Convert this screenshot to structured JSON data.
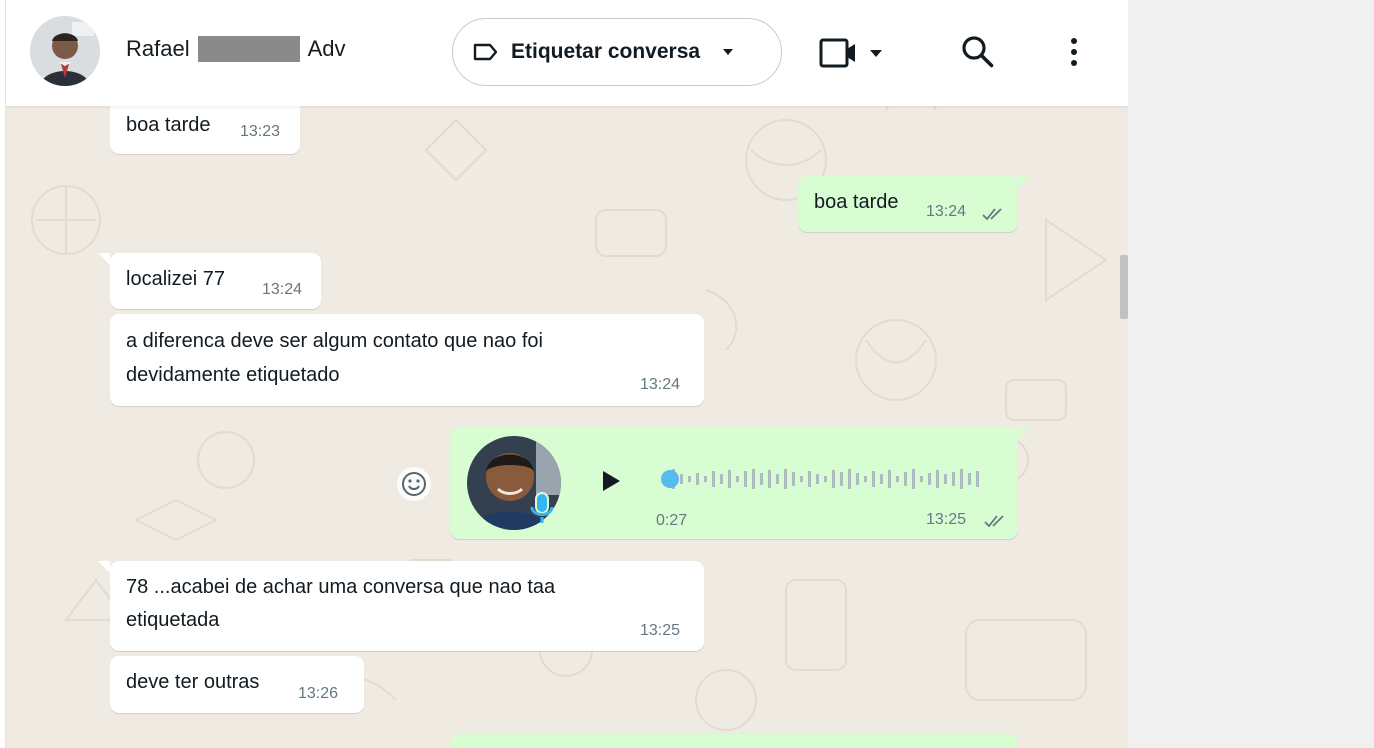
{
  "header": {
    "contact_first": "Rafael",
    "contact_last": "Adv",
    "label_button": "Etiquetar conversa",
    "icons": [
      "video-call-icon",
      "search-icon",
      "menu-dots-icon"
    ]
  },
  "messages": [
    {
      "dir": "in",
      "text": "boa tarde",
      "time": "13:23"
    },
    {
      "dir": "out",
      "text": "boa tarde",
      "time": "13:24",
      "status": "read"
    },
    {
      "dir": "in",
      "text": "localizei 77",
      "time": "13:24"
    },
    {
      "dir": "in",
      "text": "a diferenca deve ser algum contato que nao foi devidamente etiquetado",
      "line1": "a diferenca deve ser algum contato que nao foi",
      "line2": "devidamente etiquetado",
      "time": "13:24"
    },
    {
      "dir": "out",
      "type": "voice",
      "duration": "0:27",
      "time": "13:25",
      "status": "read"
    },
    {
      "dir": "in",
      "text": "78 ...acabei de achar uma conversa que nao taa etiquetada",
      "line1": "78 ...acabei de achar uma conversa que nao taa",
      "line2": "etiquetada",
      "time": "13:25"
    },
    {
      "dir": "in",
      "text": "deve ter outras",
      "time": "13:26"
    }
  ],
  "colors": {
    "incoming": "#ffffff",
    "outgoing": "#d9fdd3",
    "chat_bg": "#efeae2",
    "voice_dot": "#53bdeb",
    "read_ticks": "#667781"
  }
}
